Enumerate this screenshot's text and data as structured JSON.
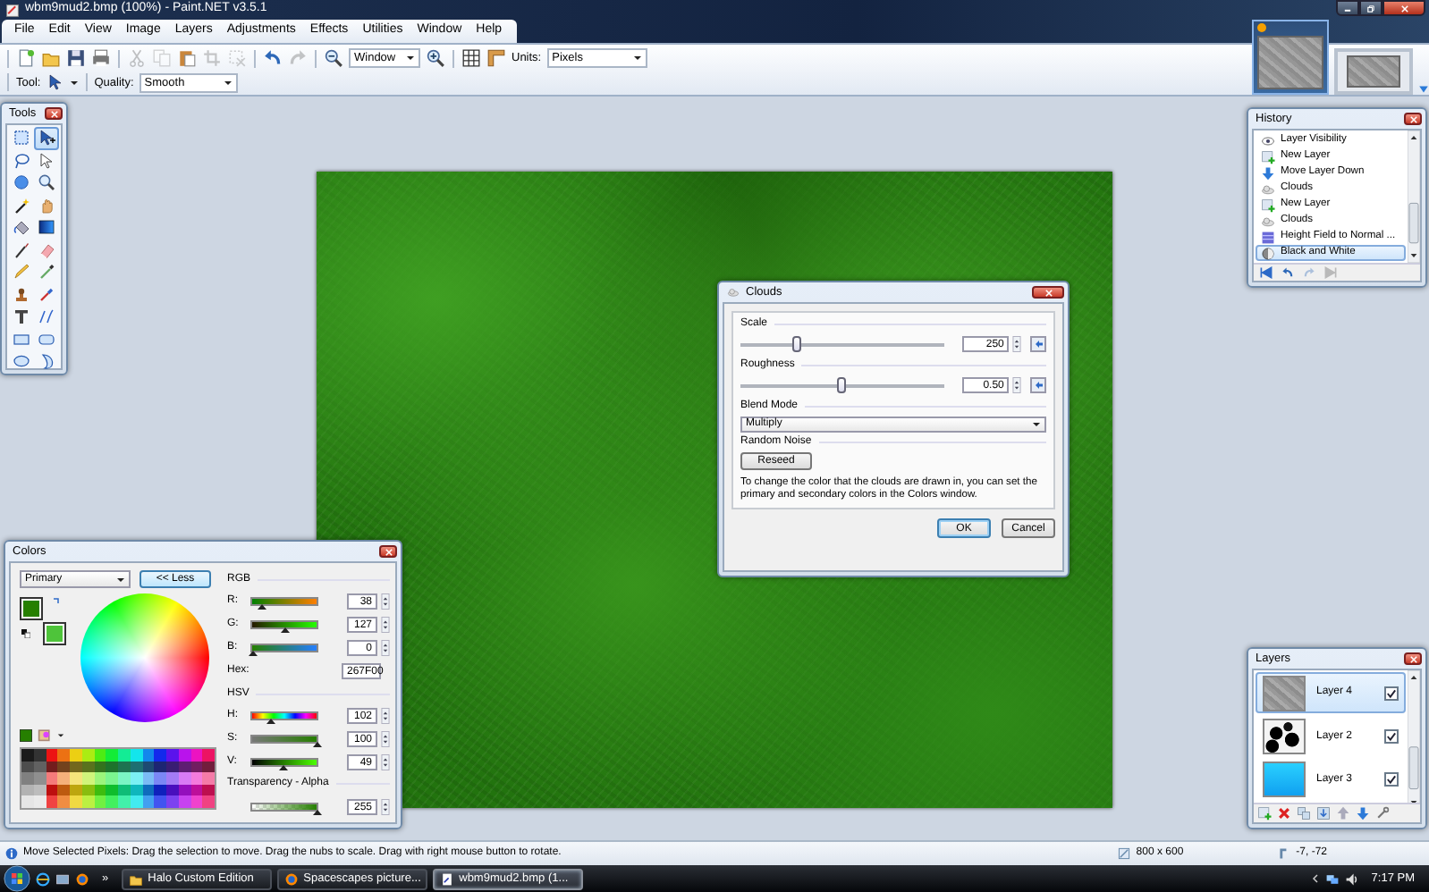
{
  "window": {
    "title": "wbm9mud2.bmp (100%) - Paint.NET v3.5.1"
  },
  "menu": [
    "File",
    "Edit",
    "View",
    "Image",
    "Layers",
    "Adjustments",
    "Effects",
    "Utilities",
    "Window",
    "Help"
  ],
  "toolbar": {
    "buttons": [
      {
        "disabled": false
      },
      {
        "disabled": false
      },
      {
        "disabled": false
      },
      {
        "disabled": false
      },
      {
        "disabled": true
      },
      {
        "disabled": true
      },
      {
        "disabled": false
      },
      {
        "disabled": true
      },
      {
        "disabled": true
      },
      {
        "disabled": false
      },
      {
        "disabled": true
      }
    ],
    "zoom": "Window",
    "units_label": "Units:",
    "units": "Pixels",
    "tool_label": "Tool:",
    "quality_label": "Quality:",
    "quality": "Smooth"
  },
  "image_tabs": [
    {
      "selected": true
    },
    {
      "selected": false
    }
  ],
  "tools": {
    "title": "Tools",
    "items": [
      {
        "selected": false
      },
      {
        "selected": true
      },
      {
        "selected": false
      },
      {
        "selected": false
      },
      {
        "selected": false
      },
      {
        "selected": false
      },
      {
        "selected": false
      },
      {
        "selected": false
      },
      {
        "selected": false
      },
      {
        "selected": false
      },
      {
        "selected": false
      },
      {
        "selected": false
      },
      {
        "selected": false
      },
      {
        "selected": false
      },
      {
        "selected": false
      },
      {
        "selected": false
      },
      {
        "selected": false
      },
      {
        "selected": false
      },
      {
        "selected": false
      },
      {
        "selected": false
      },
      {
        "selected": false
      },
      {
        "selected": false
      }
    ]
  },
  "history": {
    "title": "History",
    "items": [
      {
        "label": "Layer Visibility",
        "selected": false
      },
      {
        "label": "New Layer",
        "selected": false
      },
      {
        "label": "Move Layer Down",
        "selected": false
      },
      {
        "label": "Clouds",
        "selected": false
      },
      {
        "label": "New Layer",
        "selected": false
      },
      {
        "label": "Clouds",
        "selected": false
      },
      {
        "label": "Height Field to Normal ...",
        "selected": false
      },
      {
        "label": "Black and White",
        "selected": true
      }
    ]
  },
  "clouds": {
    "title": "Clouds",
    "scale": {
      "label": "Scale",
      "value": "250",
      "level": 0.27
    },
    "roughness": {
      "label": "Roughness",
      "value": "0.50",
      "level": 0.5
    },
    "blend": {
      "label": "Blend Mode",
      "value": "Multiply"
    },
    "noise_label": "Random Noise",
    "reseed": "Reseed",
    "help": "To change the color that the clouds are drawn in, you can set the primary and secondary colors in the Colors window.",
    "buttons": [
      {
        "label": "OK",
        "default": true
      },
      {
        "label": "Cancel",
        "default": false
      }
    ]
  },
  "colors": {
    "title": "Colors",
    "mode": "Primary",
    "toggle": "<< Less",
    "rgb_label": "RGB",
    "rgb": [
      {
        "label": "R:",
        "value": "38",
        "level": 0.15
      },
      {
        "label": "G:",
        "value": "127",
        "level": 0.5
      },
      {
        "label": "B:",
        "value": "0",
        "level": 0
      }
    ],
    "hex_label": "Hex:",
    "hex": "267F00",
    "hsv_label": "HSV",
    "hsv": [
      {
        "label": "H:",
        "value": "102",
        "level": 0.28
      },
      {
        "label": "S:",
        "value": "100",
        "level": 1
      },
      {
        "label": "V:",
        "value": "49",
        "level": 0.49
      }
    ],
    "alpha_label": "Transparency - Alpha",
    "alpha": {
      "value": "255",
      "level": 1
    }
  },
  "layers": {
    "title": "Layers",
    "items": [
      {
        "name": "Layer 4",
        "visible": true,
        "selected": true
      },
      {
        "name": "Layer 2",
        "visible": true,
        "selected": false
      },
      {
        "name": "Layer 3",
        "visible": true,
        "selected": false
      }
    ]
  },
  "status_bar": {
    "message": "Move Selected Pixels: Drag the selection to move. Drag the nubs to scale. Drag with right mouse button to rotate.",
    "size": "800 x 600",
    "position": "-7, -72"
  },
  "taskbar": {
    "more": "»",
    "tasks": [
      {
        "label": "Halo Custom Edition",
        "selected": false
      },
      {
        "label": "Spacescapes picture...",
        "selected": false
      },
      {
        "label": "wbm9mud2.bmp (1...",
        "selected": true
      }
    ],
    "clock": "7:17 PM"
  }
}
